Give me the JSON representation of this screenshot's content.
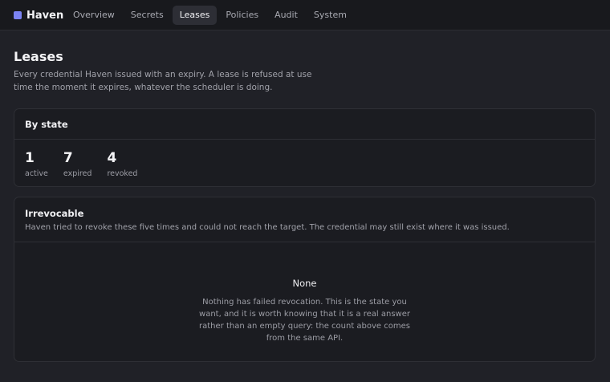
{
  "app": {
    "name": "Haven"
  },
  "nav": {
    "tabs": [
      {
        "label": "Overview"
      },
      {
        "label": "Secrets"
      },
      {
        "label": "Leases"
      },
      {
        "label": "Policies"
      },
      {
        "label": "Audit"
      },
      {
        "label": "System"
      }
    ],
    "active": "Leases"
  },
  "page": {
    "title": "Leases",
    "description": "Every credential Haven issued with an expiry. A lease is refused at use time the moment it expires, whatever the scheduler is doing."
  },
  "by_state": {
    "title": "By state",
    "stats": [
      {
        "value": "1",
        "label": "active"
      },
      {
        "value": "7",
        "label": "expired"
      },
      {
        "value": "4",
        "label": "revoked"
      }
    ]
  },
  "irrevocable": {
    "title": "Irrevocable",
    "subtitle": "Haven tried to revoke these five times and could not reach the target. The credential may still exist where it was issued.",
    "empty_title": "None",
    "empty_body": "Nothing has failed revocation. This is the state you want, and it is worth knowing that it is a real answer rather than an empty query: the count above comes from the same API."
  },
  "colors": {
    "background": "#202127",
    "topbar": "#18191d",
    "card": "#1b1c21",
    "brand_accent": "#7b83f2"
  }
}
